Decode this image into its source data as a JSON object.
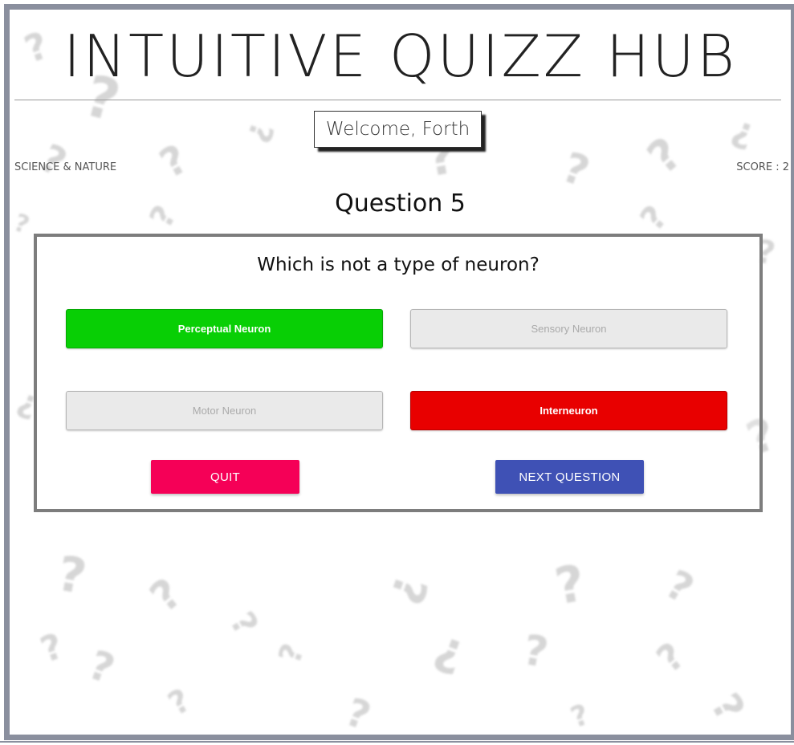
{
  "header": {
    "title": "INTUITIVE QUIZZ HUB",
    "welcome": "Welcome, Forth"
  },
  "meta": {
    "category": "SCIENCE & NATURE",
    "score": "SCORE : 2"
  },
  "quiz": {
    "question_number": "Question 5",
    "question": "Which is not a type of neuron?",
    "answers": [
      {
        "label": "Perceptual Neuron",
        "state": "correct"
      },
      {
        "label": "Sensory Neuron",
        "state": "neutral"
      },
      {
        "label": "Motor Neuron",
        "state": "neutral"
      },
      {
        "label": "Interneuron",
        "state": "wrong"
      }
    ],
    "quit_label": "QUIT",
    "next_label": "NEXT QUESTION"
  },
  "colors": {
    "frame": "#8a8f9e",
    "correct": "#08cf05",
    "wrong": "#e80000",
    "quit": "#f50057",
    "next": "#3f51b5"
  }
}
